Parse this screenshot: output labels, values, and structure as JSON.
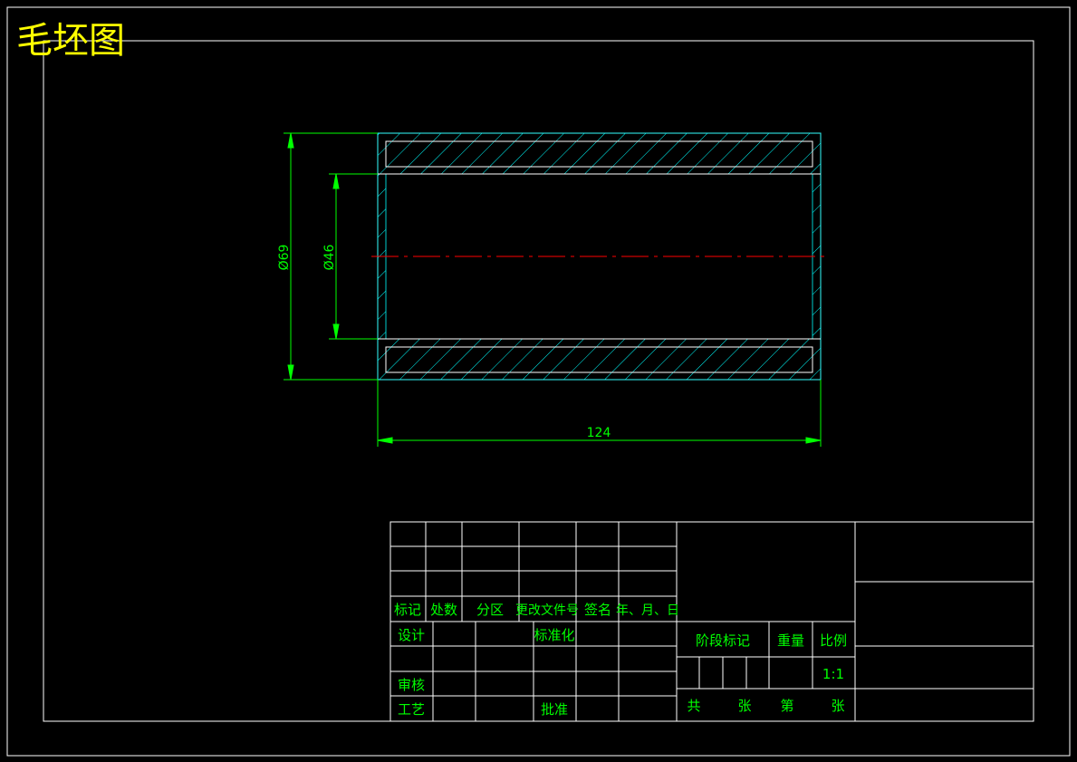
{
  "title": "毛坯图",
  "dimensions": {
    "outer_diameter": "Ø69",
    "inner_diameter": "Ø46",
    "length": "124"
  },
  "title_block": {
    "rev_headers": [
      "标记",
      "处数",
      "分区",
      "更改文件号",
      "签名",
      "年、月、日"
    ],
    "design": "设计",
    "standardize": "标准化",
    "review": "审核",
    "process": "工艺",
    "approve": "批准",
    "stage_mark": "阶段标记",
    "weight": "重量",
    "scale_label": "比例",
    "scale_value": "1:1",
    "total": "共",
    "sheet_unit": "张",
    "sheet_no": "第",
    "sheet_unit2": "张"
  },
  "colors": {
    "background": "#000000",
    "frame": "#ffffff",
    "dimension": "#00ff00",
    "hatch": "#00ffff",
    "centerline": "#ff0000",
    "title": "#ffff00"
  }
}
